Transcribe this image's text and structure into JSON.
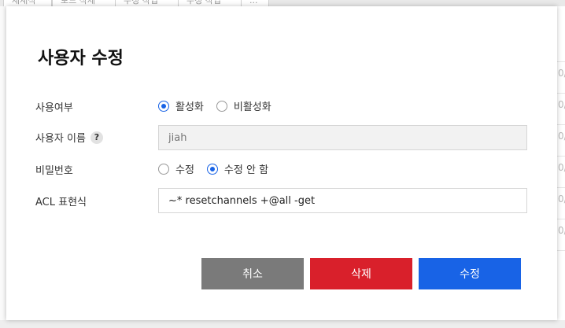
{
  "background": {
    "tabs": [
      "체재식",
      "보드 삭제",
      "수정 작업",
      "..."
    ],
    "row_glyph": "0/"
  },
  "dialog": {
    "title": "사용자 수정",
    "enabled": {
      "label": "사용여부",
      "options": [
        {
          "label": "활성화",
          "selected": true
        },
        {
          "label": "비활성화",
          "selected": false
        }
      ]
    },
    "username": {
      "label": "사용자 이름",
      "help_icon": "?",
      "placeholder": "jiah",
      "value": ""
    },
    "password": {
      "label": "비밀번호",
      "options": [
        {
          "label": "수정",
          "selected": false
        },
        {
          "label": "수정 안 함",
          "selected": true
        }
      ]
    },
    "acl": {
      "label": "ACL 표현식",
      "value": "~* resetchannels +@all -get"
    },
    "buttons": {
      "cancel": "취소",
      "delete": "삭제",
      "update": "수정"
    },
    "colors": {
      "accent": "#1863e6",
      "danger": "#d9202b",
      "neutral": "#7a7a7a"
    }
  }
}
